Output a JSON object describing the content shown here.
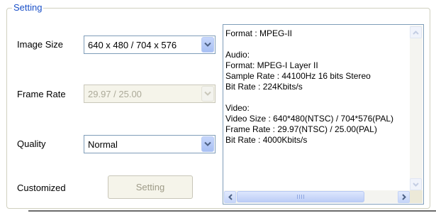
{
  "group": {
    "title": "Setting"
  },
  "image_size": {
    "label": "Image Size",
    "value": "640 x 480 / 704 x 576"
  },
  "frame_rate": {
    "label": "Frame Rate",
    "value": "29.97 / 25.00"
  },
  "quality": {
    "label": "Quality",
    "value": "Normal"
  },
  "customized": {
    "label": "Customized",
    "button_label": "Setting"
  },
  "info": {
    "text": "Format : MPEG-II\n\nAudio:\nFormat: MPEG-I Layer II\nSample Rate : 44100Hz 16 bits Stereo\nBit Rate : 224Kbits/s\n\nVideo:\nVideo Size : 640*480(NTSC) / 704*576(PAL)\nFrame Rate : 29.97(NTSC) / 25.00(PAL)\nBit Rate : 4000Kbits/s"
  },
  "icons": {
    "dropdown": "chevron-down-icon",
    "scroll_up": "arrow-up-icon",
    "scroll_down": "arrow-down-icon",
    "scroll_left": "arrow-left-icon",
    "scroll_right": "arrow-right-icon"
  },
  "colors": {
    "group_title": "#1a50c8",
    "accent": "#4d6185"
  }
}
